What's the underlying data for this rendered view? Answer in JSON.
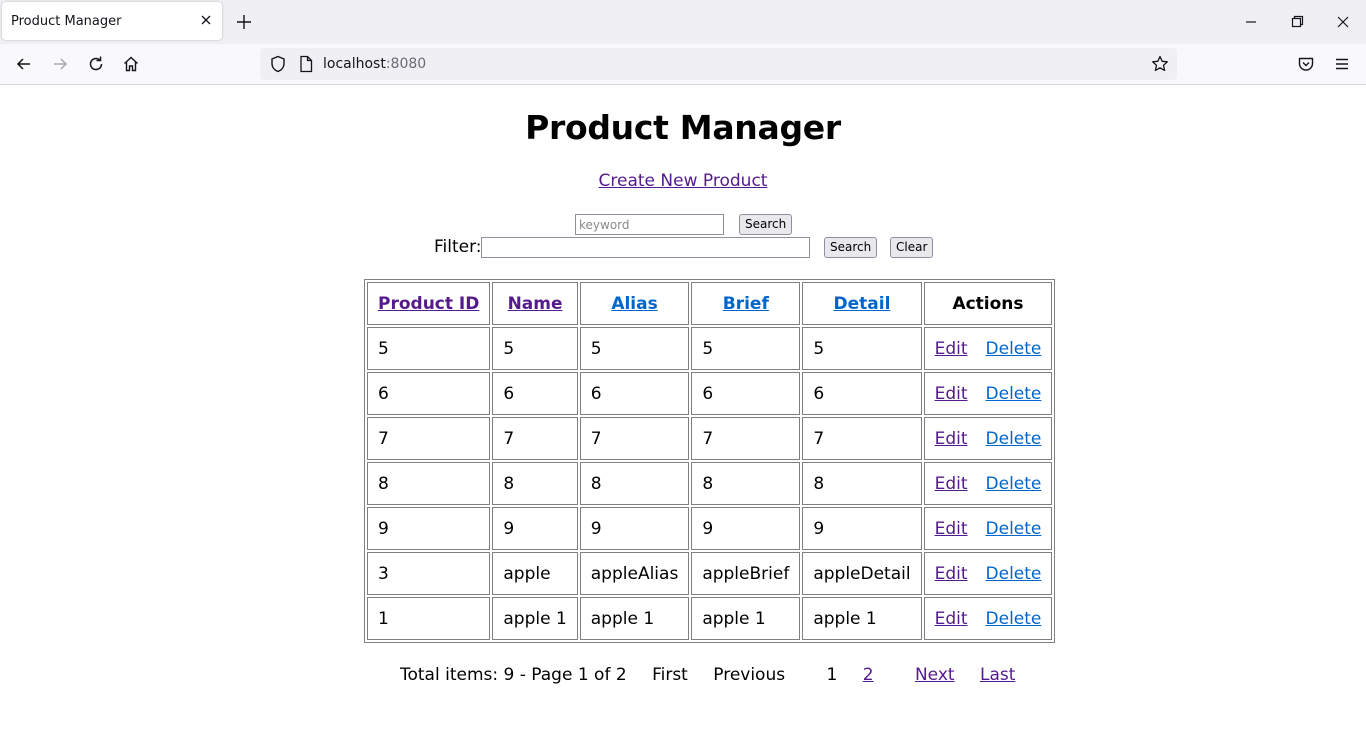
{
  "browser": {
    "tab_title": "Product Manager",
    "url_host": "localhost",
    "url_port": ":8080"
  },
  "page": {
    "title": "Product Manager",
    "create_link": "Create New Product",
    "keyword_placeholder": "keyword",
    "keyword_value": "",
    "search_label": "Search",
    "filter_label": "Filter:",
    "filter_value": "",
    "filter_search_label": "Search",
    "clear_label": "Clear"
  },
  "table": {
    "headers": [
      "Product ID",
      "Name",
      "Alias",
      "Brief",
      "Detail",
      "Actions"
    ],
    "rows": [
      [
        "5",
        "5",
        "5",
        "5",
        "5"
      ],
      [
        "6",
        "6",
        "6",
        "6",
        "6"
      ],
      [
        "7",
        "7",
        "7",
        "7",
        "7"
      ],
      [
        "8",
        "8",
        "8",
        "8",
        "8"
      ],
      [
        "9",
        "9",
        "9",
        "9",
        "9"
      ],
      [
        "3",
        "apple",
        "appleAlias",
        "appleBrief",
        "appleDetail"
      ],
      [
        "1",
        "apple 1",
        "apple 1",
        "apple 1",
        "apple 1"
      ]
    ],
    "edit_label": "Edit",
    "delete_label": "Delete"
  },
  "pager": {
    "total_text": "Total items: 9 - Page 1 of 2",
    "first": "First",
    "previous": "Previous",
    "pages": [
      "1",
      "2"
    ],
    "next": "Next",
    "last": "Last"
  },
  "colors": {
    "visited_link": "#551a8b",
    "link": "#0066cc"
  },
  "icons": [
    "close-icon",
    "plus-icon",
    "minimize-icon",
    "restore-icon",
    "window-close-icon",
    "back-icon",
    "forward-icon",
    "reload-icon",
    "home-icon",
    "shield-icon",
    "page-icon",
    "star-icon",
    "pocket-icon",
    "menu-icon"
  ]
}
